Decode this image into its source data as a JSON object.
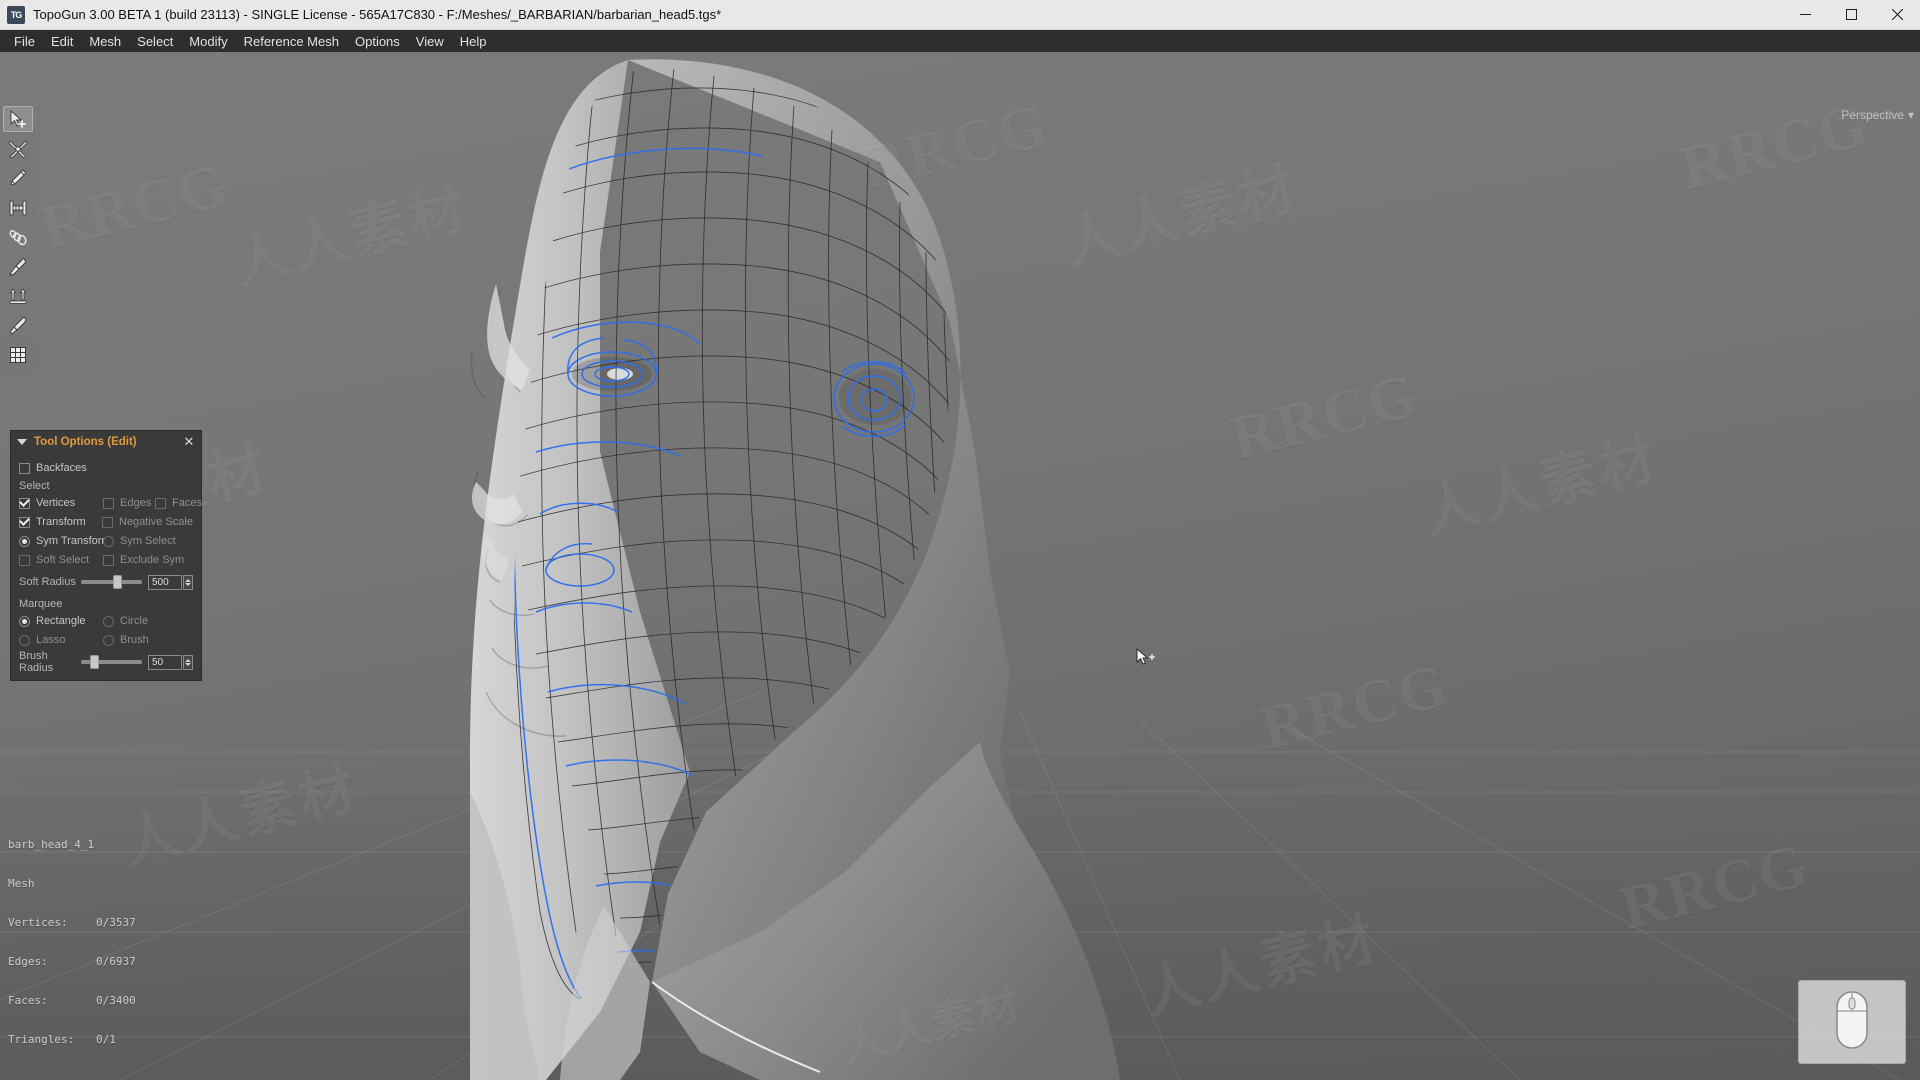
{
  "window": {
    "app_icon": "topogun-logo-icon",
    "title": "TopoGun 3.00 BETA 1 (build 23113) - SINGLE License - 565A17C830 - F:/Meshes/_BARBARIAN/barbarian_head5.tgs*",
    "minimize_label": "Minimize",
    "maximize_label": "Maximize",
    "close_label": "Close"
  },
  "menu": {
    "items": [
      {
        "label": "File"
      },
      {
        "label": "Edit"
      },
      {
        "label": "Mesh"
      },
      {
        "label": "Select"
      },
      {
        "label": "Modify"
      },
      {
        "label": "Reference Mesh"
      },
      {
        "label": "Options"
      },
      {
        "label": "View"
      },
      {
        "label": "Help"
      }
    ]
  },
  "toolbar": {
    "items": [
      {
        "name": "select-tool",
        "icon": "cursor-plus-icon",
        "active": true
      },
      {
        "name": "create-tool",
        "icon": "four-point-star-icon",
        "active": false
      },
      {
        "name": "draw-tool",
        "icon": "pencil-icon",
        "active": false
      },
      {
        "name": "bridge-tool",
        "icon": "bridge-icon",
        "active": false
      },
      {
        "name": "tubes-tool",
        "icon": "spiral-tube-icon",
        "active": false
      },
      {
        "name": "brush-tool",
        "icon": "paintbrush-icon",
        "active": false
      },
      {
        "name": "extrude-tool",
        "icon": "extrude-arrows-icon",
        "active": false
      },
      {
        "name": "knife-tool",
        "icon": "knife-icon",
        "active": false
      },
      {
        "name": "subdivide-tool",
        "icon": "grid-icon",
        "active": false
      }
    ]
  },
  "viewport": {
    "projection_label": "Perspective",
    "projection_caret": "▾"
  },
  "tool_options": {
    "title": "Tool Options (Edit)",
    "collapse_icon": "triangle-down-icon",
    "close_icon": "close-icon",
    "backfaces": {
      "label": "Backfaces",
      "checked": false
    },
    "select_section_label": "Select",
    "select_modes": [
      {
        "label": "Vertices",
        "checked": true
      },
      {
        "label": "Edges",
        "checked": false
      },
      {
        "label": "Faces",
        "checked": false
      }
    ],
    "transform": {
      "label": "Transform",
      "checked": true
    },
    "negative_scale": {
      "label": "Negative Scale",
      "checked": false
    },
    "sym_transform": {
      "label": "Sym Transform",
      "checked": true
    },
    "sym_select": {
      "label": "Sym Select",
      "checked": false
    },
    "soft_select": {
      "label": "Soft Select",
      "checked": false
    },
    "exclude_sym": {
      "label": "Exclude Sym",
      "checked": false
    },
    "soft_radius": {
      "label": "Soft Radius",
      "value": "500",
      "fill_percent": 62
    },
    "marquee_section_label": "Marquee",
    "marquee_modes": [
      {
        "label": "Rectangle",
        "checked": true
      },
      {
        "label": "Circle",
        "checked": false
      },
      {
        "label": "Lasso",
        "checked": false
      },
      {
        "label": "Brush",
        "checked": false
      }
    ],
    "brush_radius": {
      "label": "Brush Radius",
      "value": "50",
      "fill_percent": 22
    }
  },
  "status": {
    "object_name": "barb_head_4_1",
    "object_type": "Mesh",
    "rows": [
      {
        "key": "Vertices:",
        "value": "0/3537"
      },
      {
        "key": "Edges:",
        "value": "0/6937"
      },
      {
        "key": "Faces:",
        "value": "0/3400"
      },
      {
        "key": "Triangles:",
        "value": "0/1"
      }
    ]
  },
  "nav_widget": {
    "icon": "mouse-icon",
    "label": ""
  },
  "watermarks": {
    "latin": "RRCG",
    "cjk": "人人素材"
  },
  "colors": {
    "titlebar_bg": "#e8e8e8",
    "menubar_bg": "#2e2e2e",
    "panel_bg": "#3a3a3a",
    "panel_title": "#e09a3e",
    "wire_selected": "#2b6ef0",
    "wire_base": "#2a2a2a",
    "viewport_bg": "#757575"
  }
}
